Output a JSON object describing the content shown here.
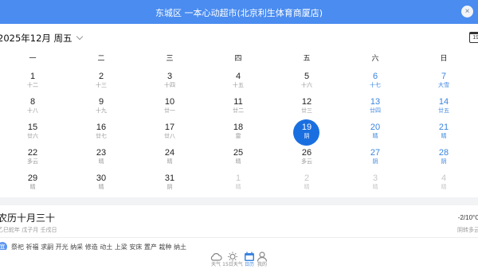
{
  "header": {
    "title": "东城区 一本心动超市(北京利生体育商厦店)",
    "close_icon": "×"
  },
  "month": {
    "label": "2025年12月 周五"
  },
  "calendar_icon_text": "19",
  "weekdays": [
    "一",
    "二",
    "三",
    "四",
    "五",
    "六",
    "日"
  ],
  "weeks": [
    [
      {
        "d": "1",
        "l": "十二",
        "t": "n"
      },
      {
        "d": "2",
        "l": "十三",
        "t": "n"
      },
      {
        "d": "3",
        "l": "十四",
        "t": "n"
      },
      {
        "d": "4",
        "l": "十五",
        "t": "n"
      },
      {
        "d": "5",
        "l": "十六",
        "t": "n"
      },
      {
        "d": "6",
        "l": "十七",
        "t": "w"
      },
      {
        "d": "7",
        "l": "大雪",
        "t": "w"
      }
    ],
    [
      {
        "d": "8",
        "l": "十八",
        "t": "n"
      },
      {
        "d": "9",
        "l": "十九",
        "t": "n"
      },
      {
        "d": "10",
        "l": "廿一",
        "t": "n"
      },
      {
        "d": "11",
        "l": "廿二",
        "t": "n"
      },
      {
        "d": "12",
        "l": "廿三",
        "t": "n"
      },
      {
        "d": "13",
        "l": "廿四",
        "t": "w"
      },
      {
        "d": "14",
        "l": "廿五",
        "t": "w"
      }
    ],
    [
      {
        "d": "15",
        "l": "廿六",
        "t": "n"
      },
      {
        "d": "16",
        "l": "廿七",
        "t": "n"
      },
      {
        "d": "17",
        "l": "廿八",
        "t": "n"
      },
      {
        "d": "18",
        "l": "雷",
        "t": "n"
      },
      {
        "d": "19",
        "l": "阴",
        "t": "today"
      },
      {
        "d": "20",
        "l": "晴",
        "t": "w"
      },
      {
        "d": "21",
        "l": "晴",
        "t": "w"
      }
    ],
    [
      {
        "d": "22",
        "l": "多云",
        "t": "n"
      },
      {
        "d": "23",
        "l": "晴",
        "t": "n"
      },
      {
        "d": "24",
        "l": "晴",
        "t": "n"
      },
      {
        "d": "25",
        "l": "晴",
        "t": "n"
      },
      {
        "d": "26",
        "l": "多云",
        "t": "n"
      },
      {
        "d": "27",
        "l": "阴",
        "t": "w"
      },
      {
        "d": "28",
        "l": "阴",
        "t": "w"
      }
    ],
    [
      {
        "d": "29",
        "l": "晴",
        "t": "n"
      },
      {
        "d": "30",
        "l": "晴",
        "t": "n"
      },
      {
        "d": "31",
        "l": "阴",
        "t": "n"
      },
      {
        "d": "1",
        "l": "晴",
        "t": "o"
      },
      {
        "d": "2",
        "l": "晴",
        "t": "o"
      },
      {
        "d": "3",
        "l": "晴",
        "t": "o"
      },
      {
        "d": "4",
        "l": "晴",
        "t": "o"
      }
    ]
  ],
  "lunar": {
    "title": "农历十月三十",
    "sub": "乙巳蛇年 戊子月 壬戌日"
  },
  "weather": {
    "temp": "-2/10°C",
    "desc": "阴转多云"
  },
  "yi": {
    "badge": "宜",
    "text": "祭祀 祈福 求嗣 开光 纳采 修造 动土 上梁 安床 置产 栽种 纳土"
  },
  "nav": [
    {
      "icon": "cloud-icon",
      "label": "天气"
    },
    {
      "icon": "sun-icon",
      "label": "15日天气"
    },
    {
      "icon": "calendar-icon",
      "label": "日历"
    },
    {
      "icon": "person-icon",
      "label": "我的"
    }
  ],
  "colors": {
    "accent": "#1a6fe0",
    "topbar": "#4a8cf0",
    "weekend": "#3a84e0"
  }
}
